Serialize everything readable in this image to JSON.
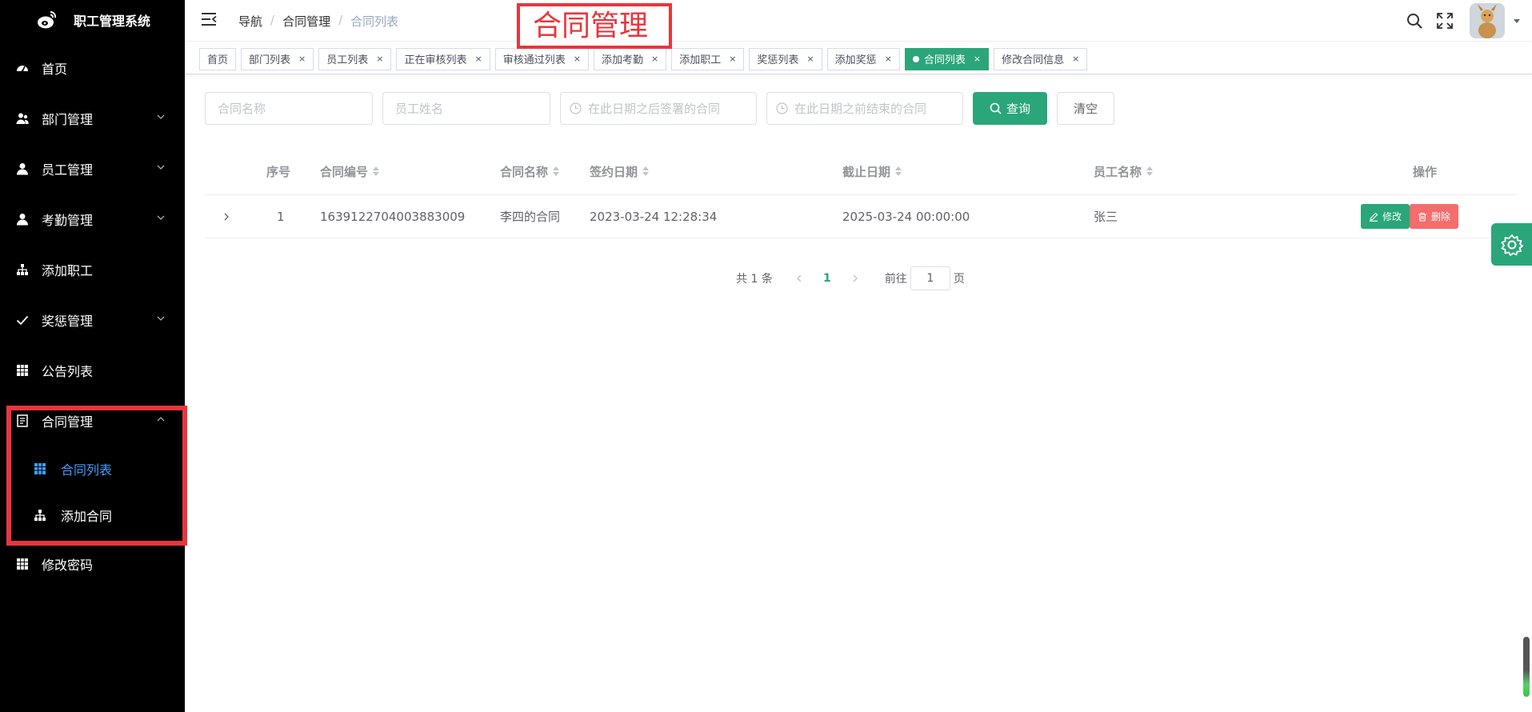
{
  "app": {
    "title": "职工管理系统"
  },
  "sidebar": {
    "items": [
      {
        "label": "首页"
      },
      {
        "label": "部门管理"
      },
      {
        "label": "员工管理"
      },
      {
        "label": "考勤管理"
      },
      {
        "label": "添加职工"
      },
      {
        "label": "奖惩管理"
      },
      {
        "label": "公告列表"
      },
      {
        "label": "合同管理"
      },
      {
        "label": "修改密码"
      }
    ],
    "contract_sub": [
      {
        "label": "合同列表"
      },
      {
        "label": "添加合同"
      }
    ]
  },
  "header": {
    "breadcrumb": [
      "导航",
      "合同管理",
      "合同列表"
    ],
    "annotation": "合同管理"
  },
  "tags": [
    {
      "label": "首页"
    },
    {
      "label": "部门列表"
    },
    {
      "label": "员工列表"
    },
    {
      "label": "正在审核列表"
    },
    {
      "label": "审核通过列表"
    },
    {
      "label": "添加考勤"
    },
    {
      "label": "添加职工"
    },
    {
      "label": "奖惩列表"
    },
    {
      "label": "添加奖惩"
    },
    {
      "label": "合同列表",
      "active": true
    },
    {
      "label": "修改合同信息"
    }
  ],
  "search": {
    "contract_name_placeholder": "合同名称",
    "employee_name_placeholder": "员工姓名",
    "after_date_placeholder": "在此日期之后签署的合同",
    "before_date_placeholder": "在此日期之前结束的合同",
    "query_label": "查询",
    "clear_label": "清空"
  },
  "table": {
    "columns": {
      "index": "序号",
      "contract_no": "合同编号",
      "contract_name": "合同名称",
      "sign_date": "签约日期",
      "end_date": "截止日期",
      "employee_name": "员工名称",
      "actions": "操作"
    },
    "rows": [
      {
        "index": "1",
        "contract_no": "1639122704003883009",
        "contract_name": "李四的合同",
        "sign_date": "2023-03-24 12:28:34",
        "end_date": "2025-03-24 00:00:00",
        "employee_name": "张三",
        "edit_label": "修改",
        "delete_label": "删除"
      }
    ]
  },
  "pagination": {
    "total_text": "共 1 条",
    "current_page": "1",
    "goto_prefix": "前往",
    "goto_value": "1",
    "goto_suffix": "页"
  },
  "colors": {
    "primary": "#2aa67a",
    "danger": "#f56c6c",
    "active_menu": "#409eff",
    "highlight": "#e8363c"
  }
}
